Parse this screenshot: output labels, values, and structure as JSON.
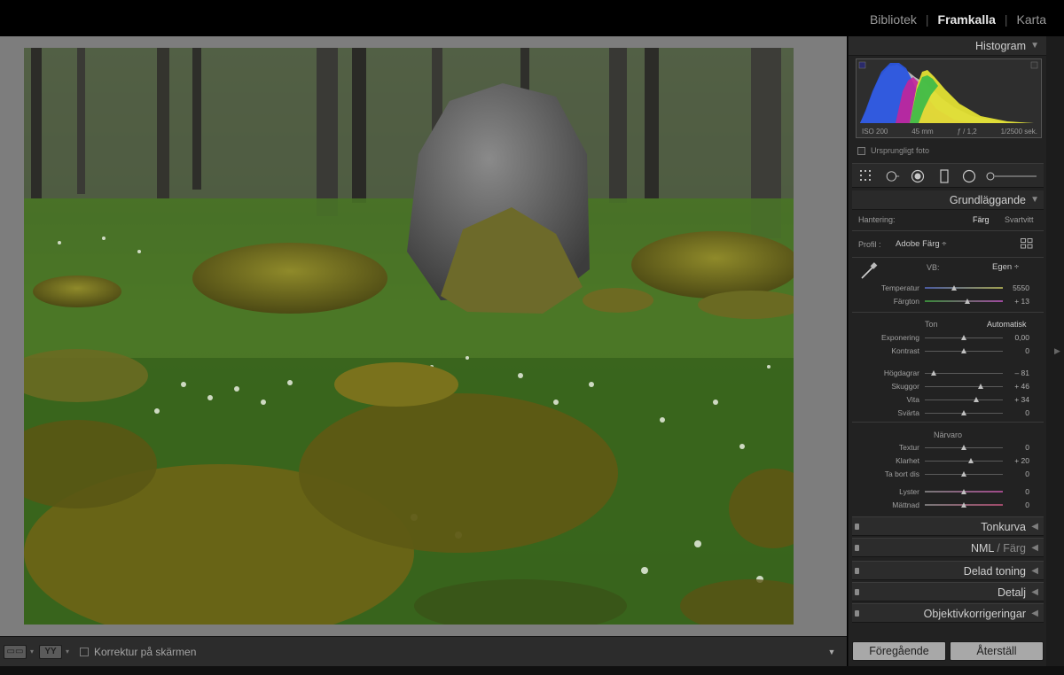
{
  "modules": {
    "library": "Bibliotek",
    "develop": "Framkalla",
    "map": "Karta",
    "separator": "|"
  },
  "toolbar": {
    "view_btn_1": "▭▭",
    "view_btn_2": "YY",
    "caret": "▾",
    "proof_label": "Korrektur på skärmen",
    "dropdown": "▼"
  },
  "histogram": {
    "title": "Histogram",
    "iso": "ISO 200",
    "focal": "45 mm",
    "aperture": "ƒ / 1,2",
    "shutter": "1/2500 sek.",
    "original_photo": "Ursprungligt foto"
  },
  "basic": {
    "title": "Grundläggande",
    "treatment_label": "Hantering:",
    "treatment_color": "Färg",
    "treatment_bw": "Svartvitt",
    "profile_label": "Profil :",
    "profile_value": "Adobe Färg ÷",
    "wb_label": "VB:",
    "wb_value": "Egen ÷",
    "tone_label": "Ton",
    "auto_label": "Automatisk",
    "presence_label": "Närvaro",
    "sliders": [
      {
        "label": "Temperatur",
        "value": "5550",
        "pos": 0.38,
        "group": "wb"
      },
      {
        "label": "Färgton",
        "value": "+ 13",
        "pos": 0.55,
        "group": "wb"
      },
      {
        "label": "Exponering",
        "value": "0,00",
        "pos": 0.5,
        "group": "tone"
      },
      {
        "label": "Kontrast",
        "value": "0",
        "pos": 0.5,
        "group": "tone"
      },
      {
        "label": "Högdagrar",
        "value": "– 81",
        "pos": 0.12,
        "group": "tone"
      },
      {
        "label": "Skuggor",
        "value": "+ 46",
        "pos": 0.72,
        "group": "tone"
      },
      {
        "label": "Vita",
        "value": "+ 34",
        "pos": 0.66,
        "group": "tone"
      },
      {
        "label": "Svärta",
        "value": "0",
        "pos": 0.5,
        "group": "tone"
      },
      {
        "label": "Textur",
        "value": "0",
        "pos": 0.5,
        "group": "presence"
      },
      {
        "label": "Klarhet",
        "value": "+ 20",
        "pos": 0.6,
        "group": "presence"
      },
      {
        "label": "Ta bort dis",
        "value": "0",
        "pos": 0.5,
        "group": "presence"
      },
      {
        "label": "Lyster",
        "value": "0",
        "pos": 0.5,
        "group": "presence"
      },
      {
        "label": "Mättnad",
        "value": "0",
        "pos": 0.5,
        "group": "presence"
      }
    ]
  },
  "panels": {
    "tone_curve": "Tonkurva",
    "hsl": "NML",
    "hsl_sep": " / ",
    "hsl_color": "Färg",
    "split_toning": "Delad toning",
    "detail": "Detalj",
    "lens": "Objektivkorrigeringar"
  },
  "buttons": {
    "previous": "Föregående",
    "reset": "Återställ"
  },
  "icons": {
    "collapse": "▼",
    "expand": "◀"
  },
  "colors": {
    "panel_bg": "#222222",
    "canvas_bg": "#7d7d7d",
    "button_bg": "#a8a8a8"
  }
}
